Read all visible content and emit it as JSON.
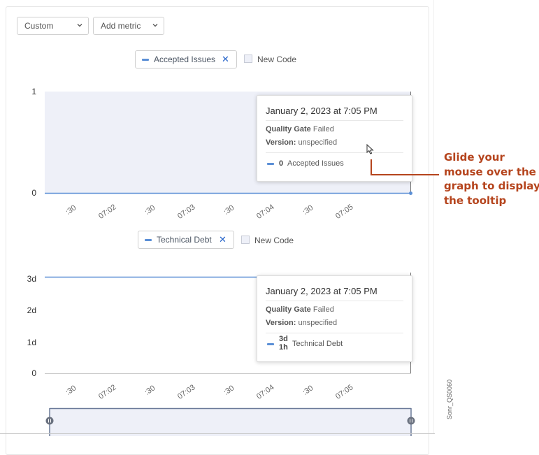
{
  "controls": {
    "graph_type": "Custom",
    "add_metric": "Add metric"
  },
  "chart1": {
    "legend_label": "Accepted Issues",
    "legend_remove": "✕",
    "new_code_label": "New Code",
    "y_ticks": [
      "1",
      "0"
    ],
    "x_ticks": [
      ":30",
      "07:02",
      ":30",
      "07:03",
      ":30",
      "07:04",
      ":30",
      "07:05"
    ],
    "tooltip": {
      "date": "January 2, 2023 at 7:05 PM",
      "quality_gate_label": "Quality Gate",
      "quality_gate_value": "Failed",
      "version_label": "Version:",
      "version_value": "unspecified",
      "series_value": "0",
      "series_name": "Accepted Issues"
    }
  },
  "chart2": {
    "legend_label": "Technical Debt",
    "legend_remove": "✕",
    "new_code_label": "New Code",
    "y_ticks": [
      "3d",
      "2d",
      "1d",
      "0"
    ],
    "x_ticks": [
      ":30",
      "07:02",
      ":30",
      "07:03",
      ":30",
      "07:04",
      ":30",
      "07:05"
    ],
    "tooltip": {
      "date": "January 2, 2023 at 7:05 PM",
      "quality_gate_label": "Quality Gate",
      "quality_gate_value": "Failed",
      "version_label": "Version:",
      "version_value": "unspecified",
      "series_value_line1": "3d",
      "series_value_line2": "1h",
      "series_name": "Technical Debt"
    }
  },
  "annotation": {
    "line1": "Glide your",
    "line2": "mouse over the",
    "line3": "graph to display",
    "line4": "the tooltip"
  },
  "side_code": "Sonr_QS0060",
  "colors": {
    "series": "#5b8fd6",
    "plot_bg": "#eef0f8",
    "annotation": "#b5441d",
    "remove_x": "#2563c9"
  }
}
